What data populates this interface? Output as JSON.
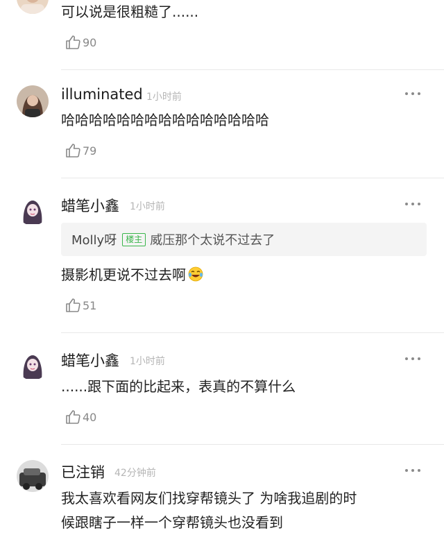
{
  "comments": [
    {
      "text": "可以说是很粗糙了......",
      "likes": "90"
    },
    {
      "username": "illuminated",
      "time": "1小时前",
      "text": "哈哈哈哈哈哈哈哈哈哈哈哈哈哈哈",
      "likes": "79",
      "avatar_icon": "user-photo-avatar"
    },
    {
      "username": "蜡笔小鑫",
      "time": "1小时前",
      "reply_to": {
        "user": "Molly呀",
        "badge": "楼主",
        "text": "威压那个太说不过去了"
      },
      "text": "摄影机更说不过去啊",
      "emoji": "laughing-tears-emoji",
      "likes": "51",
      "avatar_icon": "anime-girl-avatar"
    },
    {
      "username": "蜡笔小鑫",
      "time": "1小时前",
      "text": "......跟下面的比起来，表真的不算什么",
      "likes": "40",
      "avatar_icon": "anime-girl-avatar"
    },
    {
      "username": "已注销",
      "time": "42分钟前",
      "text_lines": [
        "我太喜欢看网友们找穿帮镜头了 为啥我追剧的时",
        "候跟瞎子一样一个穿帮镜头也没看到"
      ],
      "avatar_icon": "default-avatar"
    }
  ],
  "icons": {
    "like": "thumbs-up-icon",
    "more": "more-dots-icon"
  },
  "colors": {
    "time": "#b5b5b5",
    "badge": "#39b54a",
    "quote_bg": "#f4f4f4",
    "divider": "#e8e8e8"
  }
}
